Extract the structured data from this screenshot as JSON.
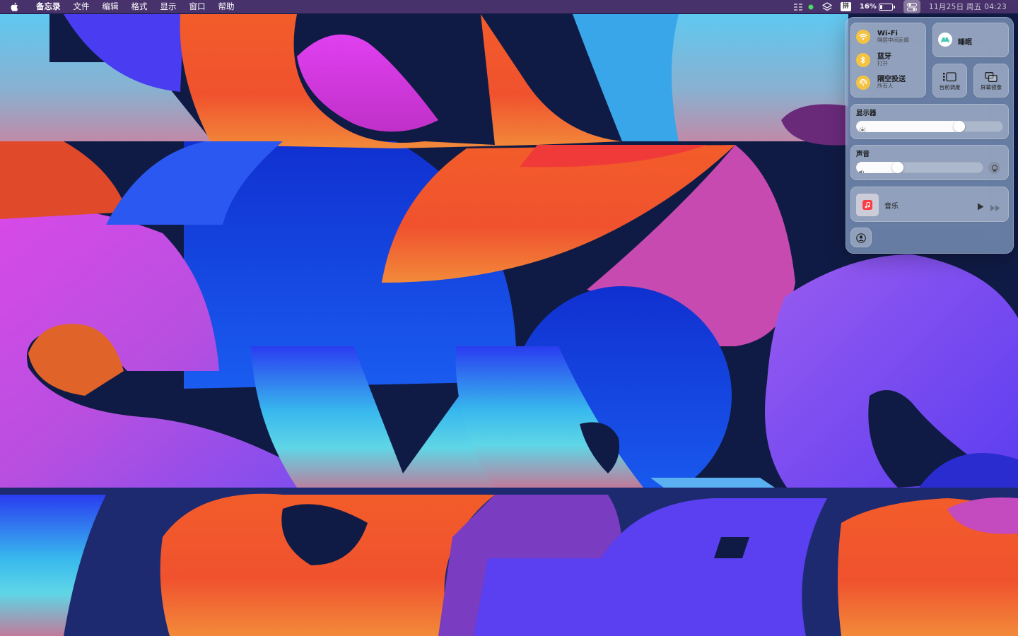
{
  "menubar": {
    "apple_icon": "apple-logo",
    "app_name": "备忘录",
    "menus": [
      "文件",
      "编辑",
      "格式",
      "显示",
      "窗口",
      "帮助"
    ],
    "status": {
      "ime_label": "拼",
      "battery_percent_text": "16%",
      "battery_level": 0.16,
      "datetime": "11月25日 周五 04:23"
    }
  },
  "control_center": {
    "wifi": {
      "title": "Wi-Fi",
      "subtitle": "隔层中间走廊",
      "icon": "wifi-icon"
    },
    "bluetooth": {
      "title": "蓝牙",
      "subtitle": "打开",
      "icon": "bluetooth-icon"
    },
    "airdrop": {
      "title": "隔空投送",
      "subtitle": "所有人",
      "icon": "airdrop-icon"
    },
    "focus": {
      "label": "睡眠",
      "icon": "bed-icon"
    },
    "stage_manager": {
      "label": "台前调度",
      "icon": "stage-manager-icon"
    },
    "screen_mirroring": {
      "label": "屏幕镜像",
      "icon": "screen-mirroring-icon"
    },
    "display": {
      "title": "显示器",
      "brightness": 0.72
    },
    "sound": {
      "title": "声音",
      "volume": 0.31
    },
    "now_playing": {
      "label": "音乐",
      "app_icon": "music-note-icon"
    },
    "accessibility_icon": "user-circle-icon"
  },
  "colors": {
    "cc_accent_yellow": "#f5c342",
    "focus_accent": "#49c7b8",
    "music_red": "#fc3c44"
  }
}
